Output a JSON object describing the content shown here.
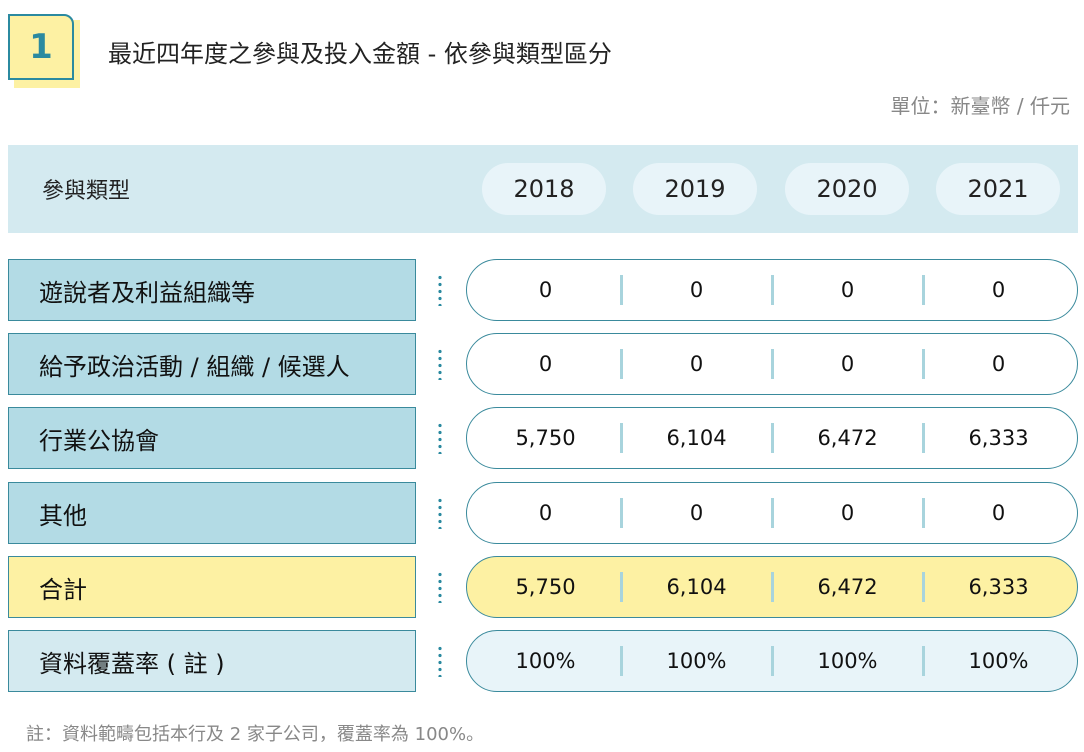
{
  "badge": {
    "number": "1"
  },
  "title": "最近四年度之參與及投入金額 - 依參與類型區分",
  "unit": "單位：新臺幣 / 仟元",
  "header": {
    "label": "參與類型",
    "years": [
      "2018",
      "2019",
      "2020",
      "2021"
    ]
  },
  "rows": [
    {
      "label": "遊說者及利益組織等",
      "values": [
        "0",
        "0",
        "0",
        "0"
      ]
    },
    {
      "label": "給予政治活動 / 組織 / 候選人",
      "values": [
        "0",
        "0",
        "0",
        "0"
      ]
    },
    {
      "label": "行業公協會",
      "values": [
        "5,750",
        "6,104",
        "6,472",
        "6,333"
      ]
    },
    {
      "label": "其他",
      "values": [
        "0",
        "0",
        "0",
        "0"
      ]
    },
    {
      "label": "合計",
      "values": [
        "5,750",
        "6,104",
        "6,472",
        "6,333"
      ]
    },
    {
      "label": "資料覆蓋率 ( 註 )",
      "values": [
        "100%",
        "100%",
        "100%",
        "100%"
      ]
    }
  ],
  "footnote": "註：資料範疇包括本行及 2 家子公司，覆蓋率為 100%。",
  "colors": {
    "accent": "#2b8aa0",
    "row_label_bg": "#b3dbe5",
    "total_bg": "#fdf1a3",
    "header_bg": "#d4eaf0"
  }
}
